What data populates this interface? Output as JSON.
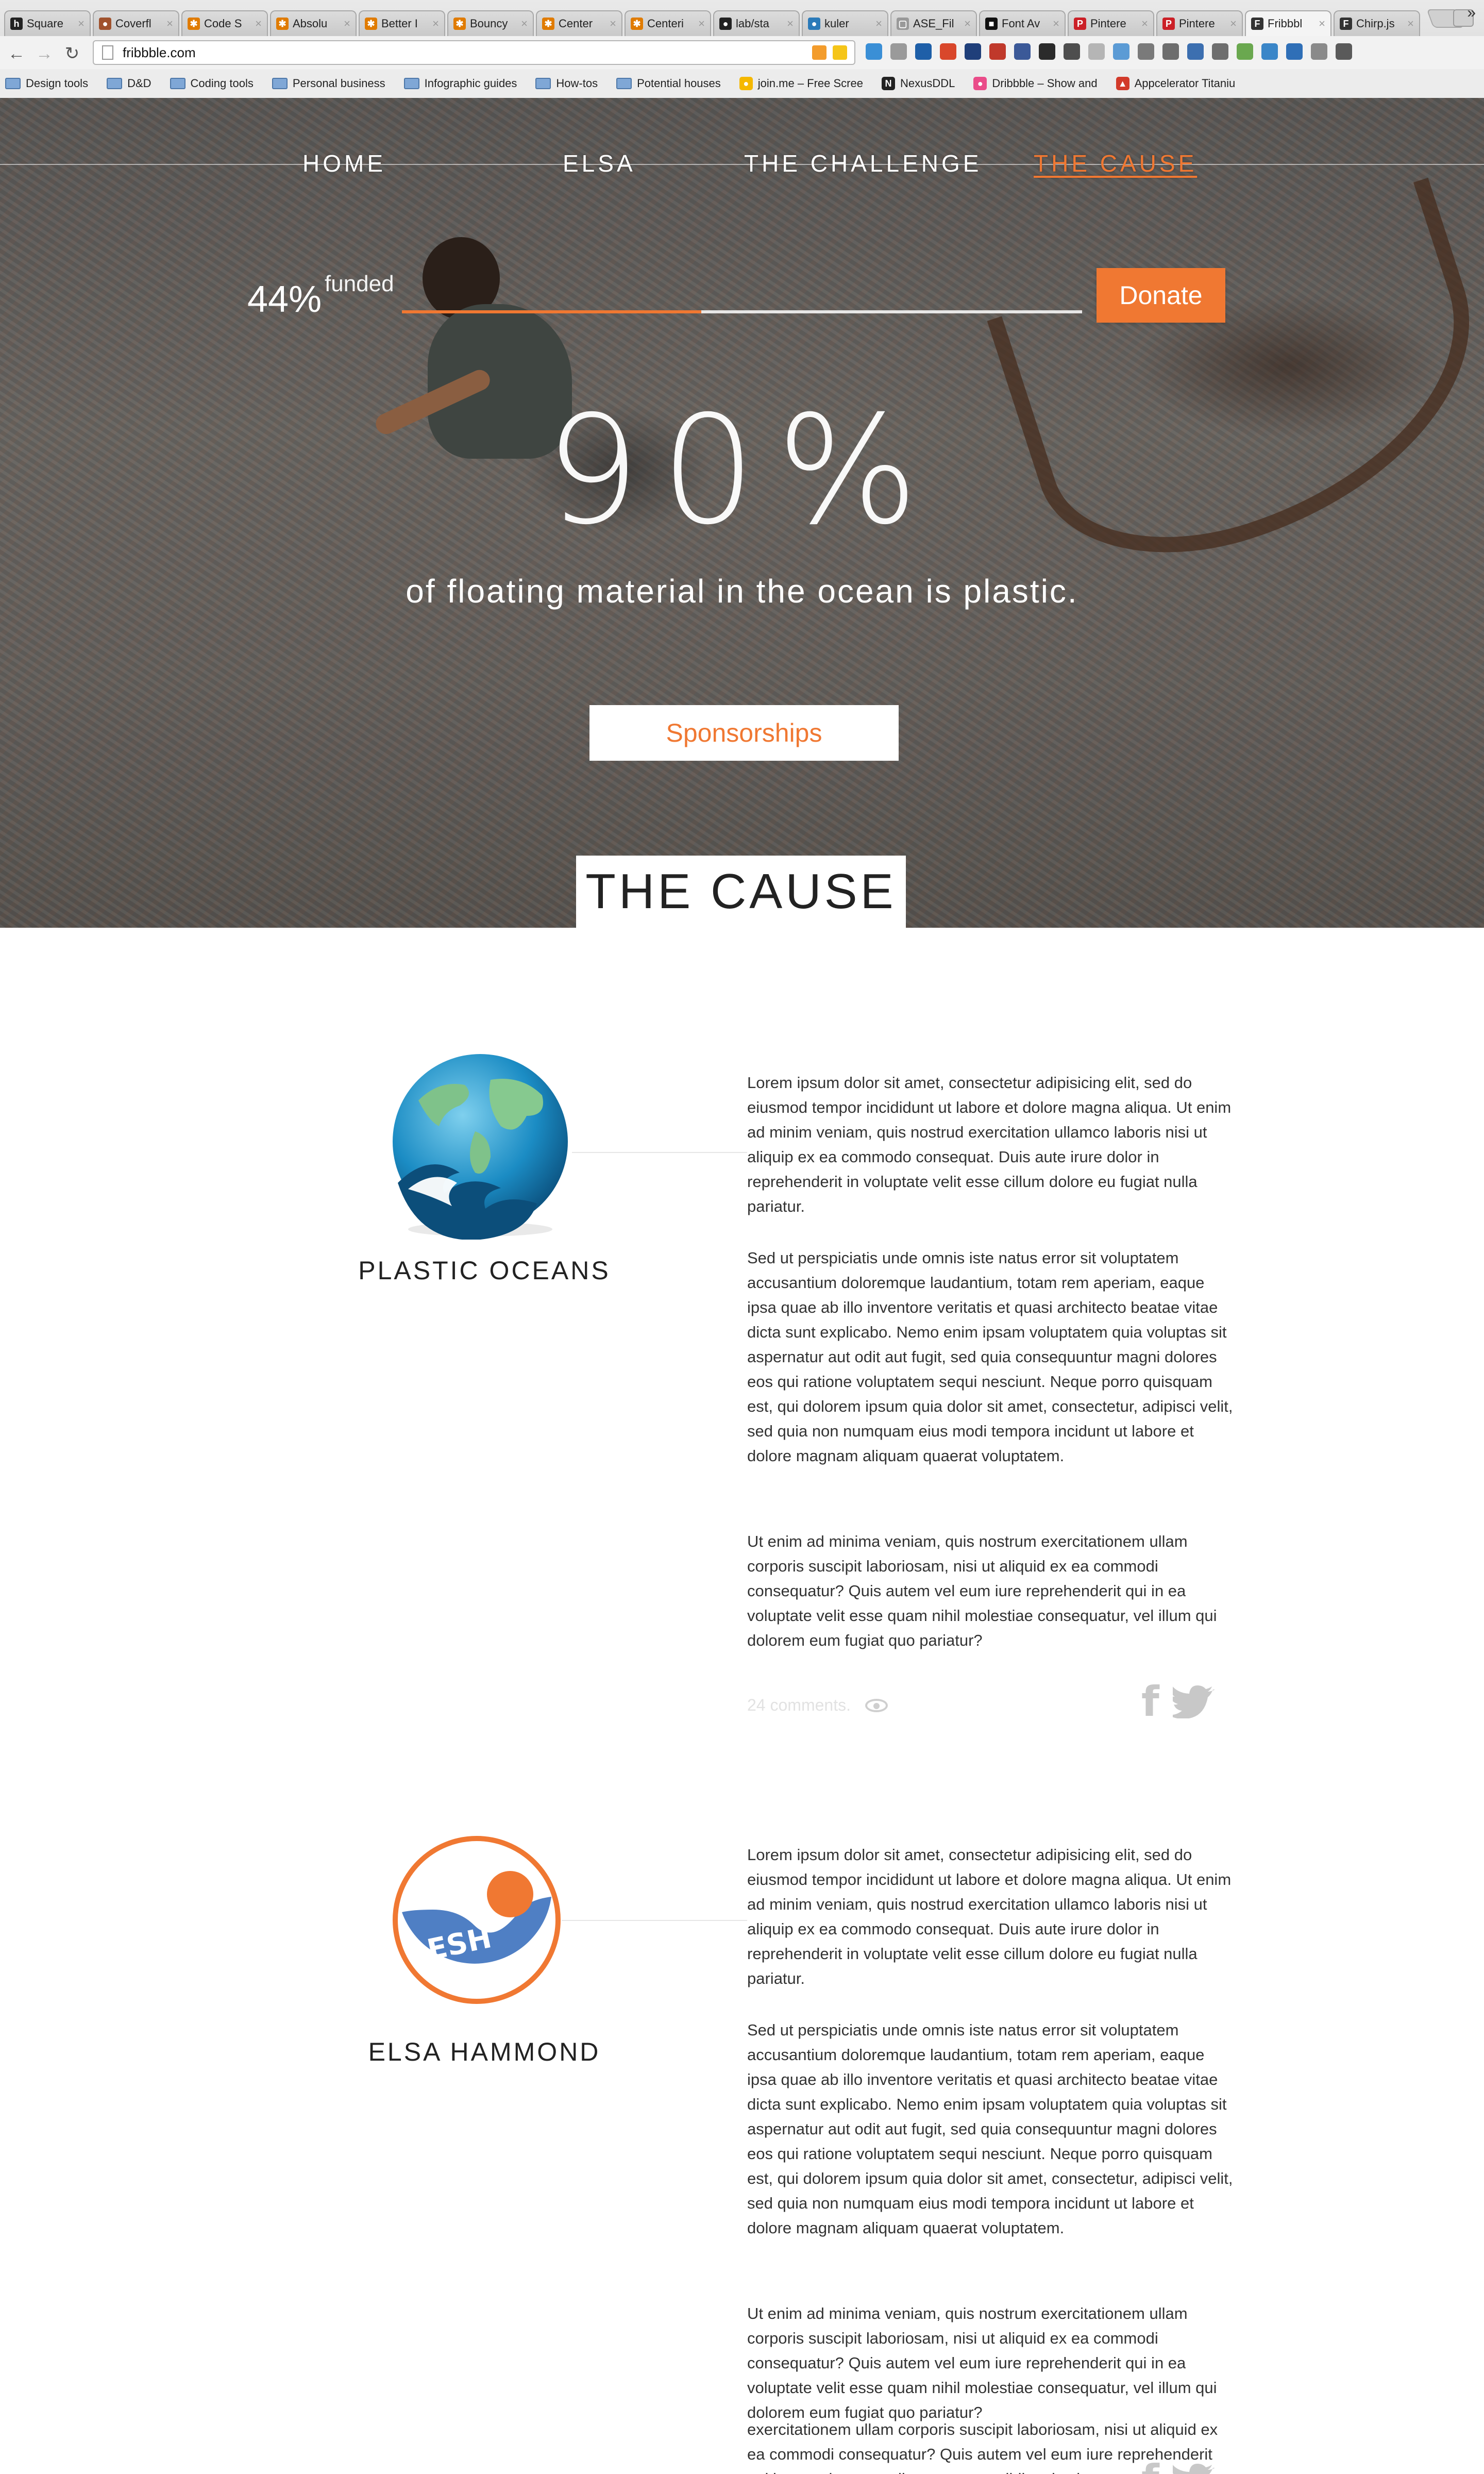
{
  "browser": {
    "tabs": [
      {
        "label": "Square",
        "fav": "h",
        "color": "#222222"
      },
      {
        "label": "Coverfl",
        "fav": "●",
        "color": "#a0522d"
      },
      {
        "label": "Code S",
        "fav": "✱",
        "color": "#e07b00"
      },
      {
        "label": "Absolu",
        "fav": "✱",
        "color": "#e07b00"
      },
      {
        "label": "Better I",
        "fav": "✱",
        "color": "#e07b00"
      },
      {
        "label": "Bouncy",
        "fav": "✱",
        "color": "#e07b00"
      },
      {
        "label": "Center",
        "fav": "✱",
        "color": "#e07b00"
      },
      {
        "label": "Centeri",
        "fav": "✱",
        "color": "#e07b00"
      },
      {
        "label": "lab/sta",
        "fav": "●",
        "color": "#222222"
      },
      {
        "label": "kuler",
        "fav": "●",
        "color": "#2a7ab9"
      },
      {
        "label": "ASE_Fil",
        "fav": "▢",
        "color": "#999999"
      },
      {
        "label": "Font Av",
        "fav": "■",
        "color": "#111111"
      },
      {
        "label": "Pintere",
        "fav": "P",
        "color": "#cb2027"
      },
      {
        "label": "Pintere",
        "fav": "P",
        "color": "#cb2027"
      },
      {
        "label": "Fribbbl",
        "fav": "F",
        "color": "#333333"
      },
      {
        "label": "Chirp.js",
        "fav": "F",
        "color": "#333333"
      }
    ],
    "active_tab": 14,
    "url": "fribbble.com",
    "bookmarks": [
      {
        "label": "Design tools",
        "type": "folder"
      },
      {
        "label": "D&D",
        "type": "folder"
      },
      {
        "label": "Coding tools",
        "type": "folder"
      },
      {
        "label": "Personal business",
        "type": "folder"
      },
      {
        "label": "Infographic guides",
        "type": "folder"
      },
      {
        "label": "How-tos",
        "type": "folder"
      },
      {
        "label": "Potential houses",
        "type": "folder"
      },
      {
        "label": "join.me – Free Scree",
        "type": "site",
        "icon": "●",
        "color": "#f5b800"
      },
      {
        "label": "NexusDDL",
        "type": "site",
        "icon": "N",
        "color": "#222222"
      },
      {
        "label": "Dribbble – Show and",
        "type": "site",
        "icon": "●",
        "color": "#ea4c89"
      },
      {
        "label": "Appcelerator Titaniu",
        "type": "site",
        "icon": "▲",
        "color": "#d23a2a"
      }
    ],
    "more": "»"
  },
  "nav": {
    "items": [
      "HOME",
      "ELSA",
      "THE CHALLENGE",
      "THE CAUSE"
    ],
    "active": 3
  },
  "funding": {
    "percent_text": "44%",
    "label": "funded",
    "progress": 0.44,
    "donate_label": "Donate"
  },
  "hero": {
    "stat": "90%",
    "stat_caption": "of floating material in the ocean is plastic.",
    "sponsor_label": "Sponsorships",
    "section_title": "THE CAUSE"
  },
  "entries": [
    {
      "name": "PLASTIC OCEANS",
      "avatar": "globe-wave-icon",
      "paragraphs": [
        "Lorem ipsum dolor sit amet, consectetur adipisicing elit, sed do eiusmod tempor incididunt ut labore et dolore magna aliqua. Ut enim ad minim veniam, quis nostrud exercitation ullamco laboris nisi ut aliquip ex ea commodo consequat. Duis aute irure dolor in reprehenderit in voluptate velit esse cillum dolore eu fugiat nulla pariatur.",
        "Sed ut perspiciatis unde omnis iste natus error sit voluptatem accusantium doloremque laudantium, totam rem aperiam, eaque ipsa quae ab illo inventore veritatis et quasi architecto beatae vitae dicta sunt explicabo. Nemo enim ipsam voluptatem quia voluptas sit aspernatur aut odit aut fugit, sed quia consequuntur magni dolores eos qui ratione voluptatem sequi nesciunt. Neque porro quisquam est, qui dolorem ipsum quia dolor sit amet, consectetur, adipisci velit, sed quia non numquam eius modi tempora incidunt ut labore et dolore magnam aliquam quaerat voluptatem.",
        "Ut enim ad minima veniam, quis nostrum exercitationem ullam corporis suscipit laboriosam, nisi ut aliquid ex ea commodi consequatur? Quis autem vel eum iure reprehenderit qui in ea voluptate velit esse quam nihil molestiae consequatur, vel illum qui dolorem eum fugiat quo pariatur?"
      ],
      "comments": "24 comments."
    },
    {
      "name": "ELSA HAMMOND",
      "avatar": "elsa-logo-icon",
      "paragraphs": [
        "Lorem ipsum dolor sit amet, consectetur adipisicing elit, sed do eiusmod tempor incididunt ut labore et dolore magna aliqua. Ut enim ad minim veniam, quis nostrud exercitation ullamco laboris nisi ut aliquip ex ea commodo consequat. Duis aute irure dolor in reprehenderit in voluptate velit esse cillum dolore eu fugiat nulla pariatur.",
        "Sed ut perspiciatis unde omnis iste natus error sit voluptatem accusantium doloremque laudantium, totam rem aperiam, eaque ipsa quae ab illo inventore veritatis et quasi architecto beatae vitae dicta sunt explicabo. Nemo enim ipsam voluptatem quia voluptas sit aspernatur aut odit aut fugit, sed quia consequuntur magni dolores eos qui ratione voluptatem sequi nesciunt. Neque porro quisquam est, qui dolorem ipsum quia dolor sit amet, consectetur, adipisci velit, sed quia non numquam eius modi tempora incidunt ut labore et dolore magnam aliquam quaerat voluptatem.",
        "Ut enim ad minima veniam, quis nostrum exercitationem ullam corporis suscipit laboriosam, nisi ut aliquid ex ea commodi consequatur? Quis autem vel eum iure reprehenderit qui in ea voluptate velit esse quam nihil molestiae consequatur, vel illum qui dolorem eum fugiat quo pariatur?"
      ],
      "overflow_text": "exercitationem ullam corporis suscipit laboriosam, nisi ut aliquid ex ea commodi consequatur? Quis autem vel eum iure reprehenderit qui in ea voluptate velit esse quam nihil molestiae"
    }
  ],
  "colors": {
    "accent": "#f07832",
    "elsa_blue": "#4f7fc4"
  }
}
